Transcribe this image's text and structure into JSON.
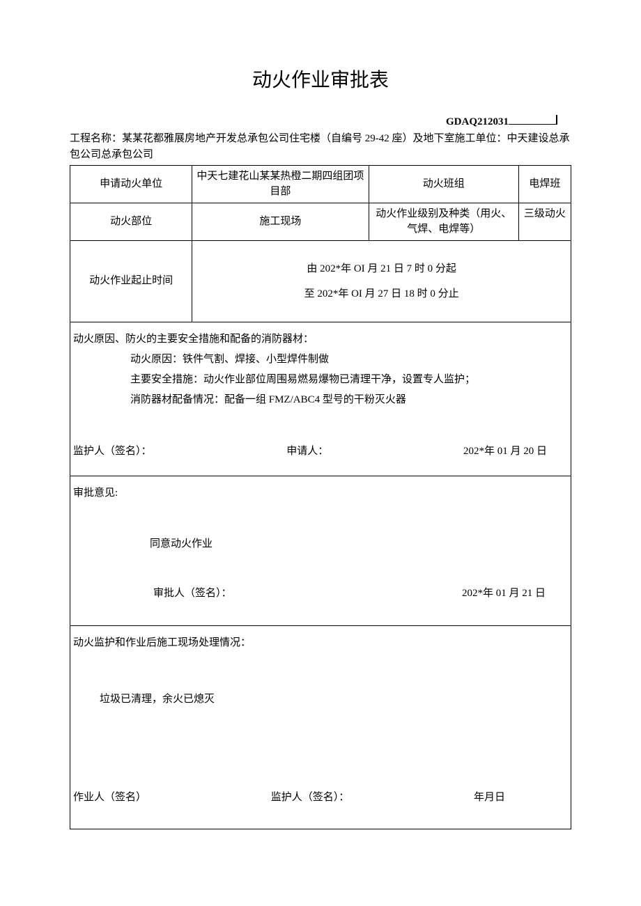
{
  "title": "动火作业审批表",
  "form_code": "GDAQ212031",
  "project_label": "工程名称：",
  "project_text": "某某花都雅展房地产开发总承包公司住宅楼（自编号 29-42 座）及地下室施工单位：中天建设总承包公司总承包公司",
  "row1": {
    "c1": "申请动火单位",
    "c2": "中天七建花山某某热橙二期四组团项目部",
    "c3": "动火班组",
    "c4": "电焊班"
  },
  "row2": {
    "c1": "动火部位",
    "c2": "施工现场",
    "c3": "动火作业级别及种类（用火、气焊、电焊等）",
    "c4": "三级动火"
  },
  "row3": {
    "c1": "动火作业起止时间",
    "line1": "由 202*年 OI 月 21 日 7 时 0 分起",
    "line2": "至 202*年 OI 月 27 日 18 时 0 分止"
  },
  "block1": {
    "heading": "动火原因、防火的主要安全措施和配备的消防器材：",
    "line_reason": "动火原因：铁件气割、焊接、小型焊件制做",
    "line_measure": "主要安全措施：动火作业部位周围易燃易爆物已清理干净，设置专人监护；",
    "line_equip": "消防器材配备情况：配备一组 FMZ/ABC4 型号的干粉灭火器",
    "sign_supervisor": "监护人（签名）：",
    "sign_applicant": "申请人：",
    "sign_date": "202*年 01 月 20 日"
  },
  "block2": {
    "heading": "审批意见:",
    "text": "同意动火作业",
    "sign_approver": "审批人（签名）：",
    "sign_date": "202*年 01 月 21 日"
  },
  "block3": {
    "heading": "动火监护和作业后施工现场处理情况：",
    "text": "垃圾已清理，余火已熄灭",
    "sign_operator": "作业人（签名）",
    "sign_supervisor": "监护人（签名）：",
    "sign_date": "年月日"
  }
}
